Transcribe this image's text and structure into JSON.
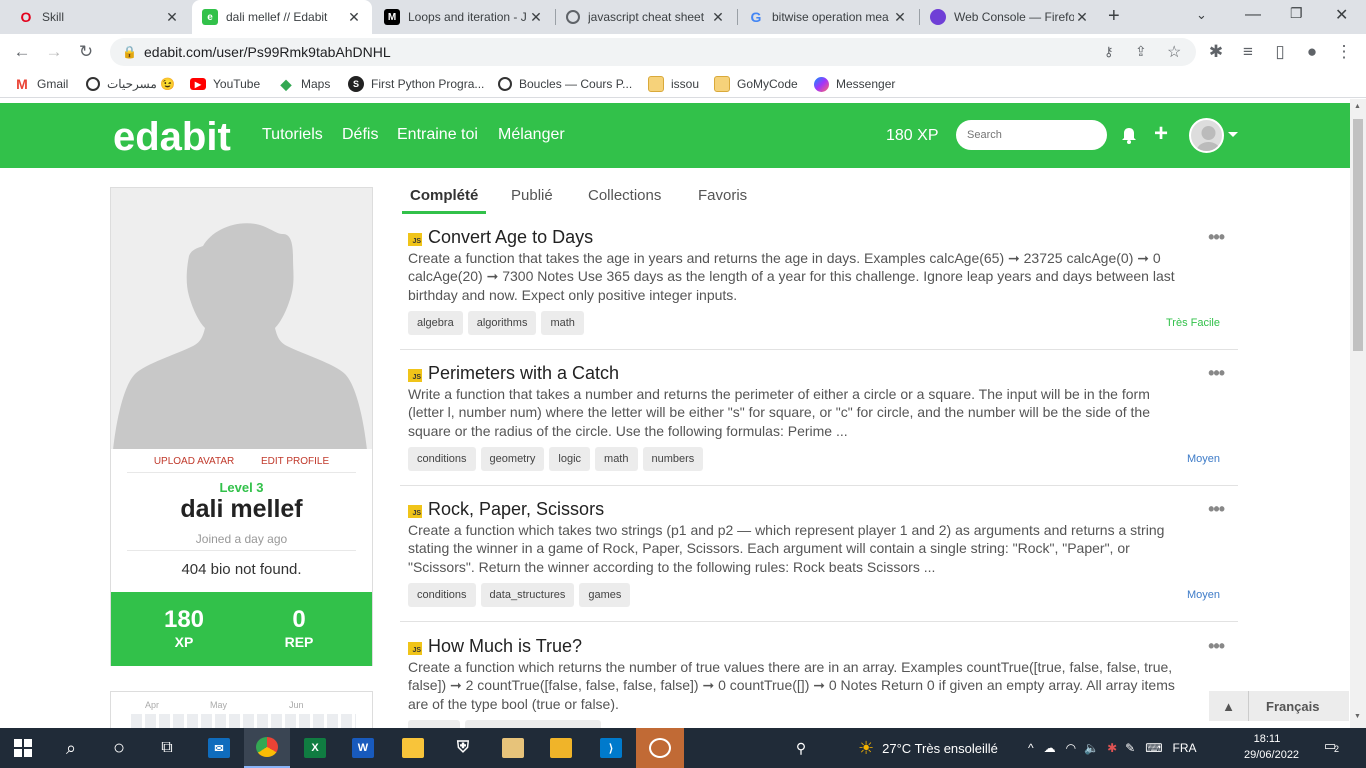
{
  "browser": {
    "tabs": [
      {
        "title": "Skill",
        "favicon": "opera-icon"
      },
      {
        "title": "dali mellef // Edabit",
        "favicon": "edabit-icon",
        "active": true
      },
      {
        "title": "Loops and iteration - J",
        "favicon": "mdn-icon"
      },
      {
        "title": "javascript cheat sheet",
        "favicon": "globe-icon"
      },
      {
        "title": "bitwise operation mea",
        "favicon": "google-icon"
      },
      {
        "title": "Web Console — Firefo",
        "favicon": "firefox-icon"
      }
    ],
    "new_tab": "+",
    "url": "edabit.com/user/Ps99Rmk9tabAhDNHL",
    "bookmarks": [
      "Gmail",
      "مسرحيات 😉",
      "YouTube",
      "Maps",
      "First Python Progra...",
      "Boucles — Cours P...",
      "issou",
      "GoMyCode",
      "Messenger"
    ]
  },
  "header": {
    "logo": "edabit",
    "nav": [
      "Tutoriels",
      "Défis",
      "Entraine toi",
      "Mélanger"
    ],
    "xp": "180 XP",
    "search_placeholder": "Search",
    "accent": "#32c14a"
  },
  "profile": {
    "upload_avatar": "UPLOAD AVATAR",
    "edit_profile": "EDIT PROFILE",
    "level": "Level 3",
    "name": "dali mellef",
    "joined": "Joined a day ago",
    "bio": "404 bio not found.",
    "xp_value": "180",
    "xp_label": "XP",
    "rep_value": "0",
    "rep_label": "REP",
    "heatmap_months": [
      "Apr",
      "May",
      "Jun"
    ]
  },
  "content_tabs": [
    "Complété",
    "Publié",
    "Collections",
    "Favoris"
  ],
  "challenges": [
    {
      "badge": "JS",
      "title": "Convert Age to Days",
      "description": "Create a function that takes the age in years and returns the age in days. Examples calcAge(65) ➞ 23725 calcAge(0) ➞ 0 calcAge(20) ➞ 7300 Notes Use 365 days as the length of a year for this challenge. Ignore leap years and days between last birthday and now. Expect only positive integer inputs.",
      "tags": [
        "algebra",
        "algorithms",
        "math"
      ],
      "difficulty": "Très Facile",
      "difficulty_color": "#32c14a"
    },
    {
      "badge": "JS",
      "title": "Perimeters with a Catch",
      "description": "Write a function that takes a number and returns the perimeter of either a circle or a square. The input will be in the form (letter l, number num) where the letter will be either \"s\" for square, or \"c\" for circle, and the number will be the side of the square or the radius of the circle. Use the following formulas: Perime ...",
      "tags": [
        "conditions",
        "geometry",
        "logic",
        "math",
        "numbers"
      ],
      "difficulty": "Moyen",
      "difficulty_color": "#3d7bc8"
    },
    {
      "badge": "JS",
      "title": "Rock, Paper, Scissors",
      "description": "Create a function which takes two strings (p1 and p2 — which represent player 1 and 2) as arguments and returns a string stating the winner in a game of Rock, Paper, Scissors. Each argument will contain a single string: \"Rock\", \"Paper\", or \"Scissors\". Return the winner according to the following rules: Rock beats Scissors ...",
      "tags": [
        "conditions",
        "data_structures",
        "games"
      ],
      "difficulty": "Moyen",
      "difficulty_color": "#3d7bc8"
    },
    {
      "badge": "JS",
      "title": "How Much is True?",
      "description": "Create a function which returns the number of true values there are in an array. Examples countTrue([true, false, false, true, false]) ➞ 2 countTrue([false, false, false, false]) ➞ 0 countTrue([]) ➞ 0 Notes Return 0 if given an empty array. All array items are of the type bool (true or false).",
      "tags": [],
      "difficulty": "",
      "difficulty_color": "#3d7bc8"
    }
  ],
  "language_button": "Français",
  "taskbar": {
    "weather": "27°C  Très ensoleillé",
    "lang": "FRA",
    "time": "18:11",
    "date": "29/06/2022",
    "notifications": "2"
  }
}
